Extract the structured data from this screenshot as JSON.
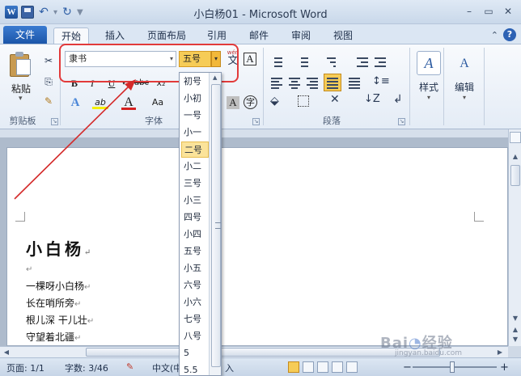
{
  "window": {
    "title": "小白杨01 - Microsoft Word",
    "app_logo": "W",
    "controls": {
      "minimize": "–",
      "restore": "▭",
      "close": "✕"
    }
  },
  "qat": {
    "undo_icon": "↶",
    "redo_icon": "↻",
    "more_icon": "▼"
  },
  "tabs": {
    "file": "文件",
    "items": [
      "开始",
      "插入",
      "页面布局",
      "引用",
      "邮件",
      "审阅",
      "视图"
    ],
    "active": "开始",
    "help_icon": "?",
    "collapse_icon": "⌃"
  },
  "ribbon": {
    "clipboard": {
      "label": "剪贴板",
      "paste": "粘贴",
      "paste_arrow": "▾",
      "cut_icon": "✂",
      "copy_icon": "⎘",
      "painter_icon": "✎"
    },
    "font": {
      "label": "字体",
      "font_name": "隶书",
      "font_size": "五号",
      "dd_arrow": "▾",
      "wen_icon": "wén",
      "wen_char": "文",
      "border_char": "A",
      "bold": "B",
      "italic": "I",
      "underline": "U",
      "strike": "abc",
      "sub": "x₂",
      "text_effect": "A",
      "highlight": "ab",
      "font_color": "A",
      "case": "Aa",
      "shade_char": "A",
      "enclose_char": "字"
    },
    "paragraph": {
      "label": "段落"
    },
    "styles": {
      "label": "样式",
      "icon_text": "A"
    },
    "editing": {
      "label": "编辑",
      "icon_text": "A"
    }
  },
  "size_dropdown": {
    "options": [
      "初号",
      "小初",
      "一号",
      "小一",
      "二号",
      "小二",
      "三号",
      "小三",
      "四号",
      "小四",
      "五号",
      "小五",
      "六号",
      "小六",
      "七号",
      "八号",
      "5",
      "5.5"
    ],
    "highlighted": "二号"
  },
  "document": {
    "title": "小白杨",
    "lines": [
      "一棵呀小白杨",
      "长在哨所旁",
      "根儿深  干儿壮",
      "守望着北疆"
    ],
    "para_mark": "↵"
  },
  "statusbar": {
    "page": "页面: 1/1",
    "words": "字数: 3/46",
    "language": "中文(中",
    "insert": "入",
    "zoom_pct": 100,
    "zoom_minus": "−",
    "zoom_plus": "+"
  },
  "watermark": {
    "text": "Bai 经验",
    "sub": "jingyan.baidu.com"
  },
  "colors": {
    "file_tab": "#2b68c1",
    "highlight": "#f6cc57",
    "annotation": "#e23a3a"
  }
}
